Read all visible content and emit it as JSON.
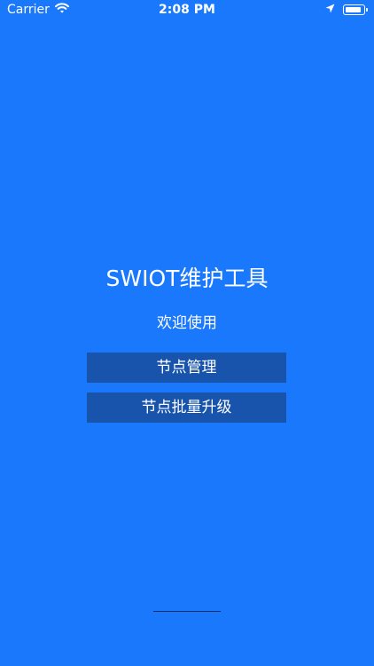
{
  "status_bar": {
    "carrier": "Carrier",
    "time": "2:08 PM",
    "icons": [
      "wifi-icon",
      "location-arrow-icon",
      "battery-icon"
    ]
  },
  "main": {
    "title": "SWIOT维护工具",
    "welcome": "欢迎使用",
    "buttons": [
      {
        "label": "节点管理"
      },
      {
        "label": "节点批量升级"
      }
    ]
  },
  "colors": {
    "background": "#1a78fd",
    "button_background": "#1854ac",
    "text": "#ffffff"
  }
}
